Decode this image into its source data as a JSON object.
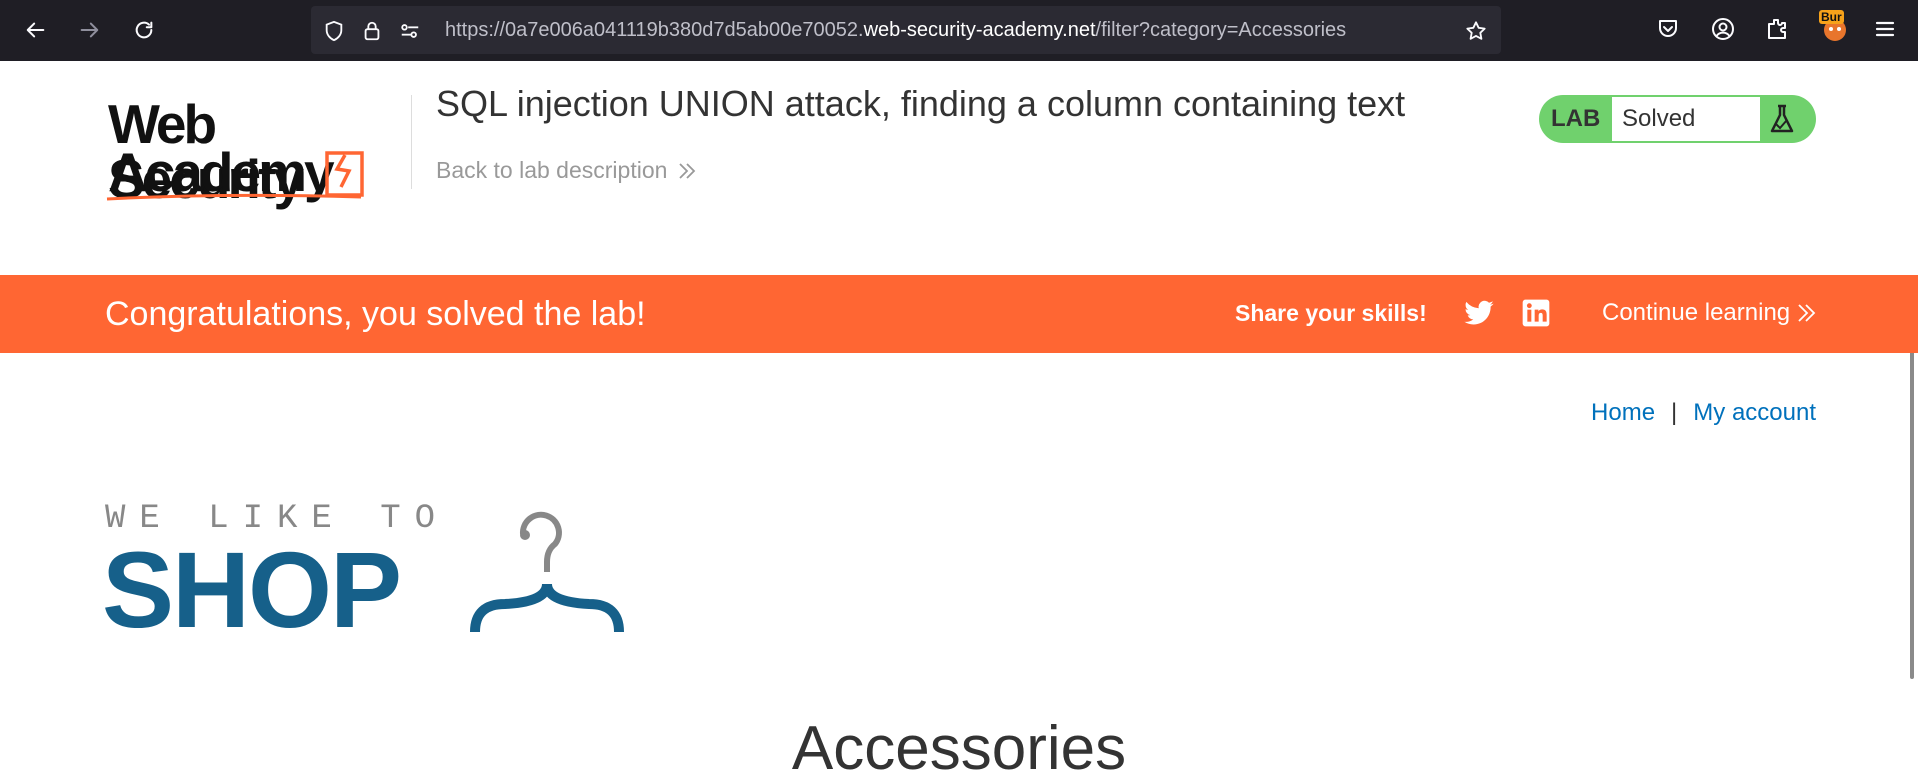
{
  "browser": {
    "url_prefix": "https://0a7e006a041119b380d7d5ab00e70052.",
    "url_host": "web-security-academy.net",
    "url_path": "/filter?category=Accessories",
    "burp_label": "Bur"
  },
  "header": {
    "logo_line1": "Web Security",
    "logo_line2": "Academy",
    "lab_title": "SQL injection UNION attack, finding a column containing text",
    "back_link": "Back to lab description",
    "lab_badge_label": "LAB",
    "lab_status": "Solved"
  },
  "banner": {
    "message": "Congratulations, you solved the lab!",
    "share_label": "Share your skills!",
    "continue_label": "Continue learning"
  },
  "nav": {
    "home": "Home",
    "separator": "|",
    "my_account": "My account"
  },
  "shop_logo": {
    "tagline": "WE LIKE TO",
    "word": "SHOP"
  },
  "page": {
    "heading": "Accessories"
  },
  "colors": {
    "banner": "#ff6633",
    "lab_badge": "#70d16d",
    "link": "#0071bc",
    "shop_blue": "#16608a"
  }
}
